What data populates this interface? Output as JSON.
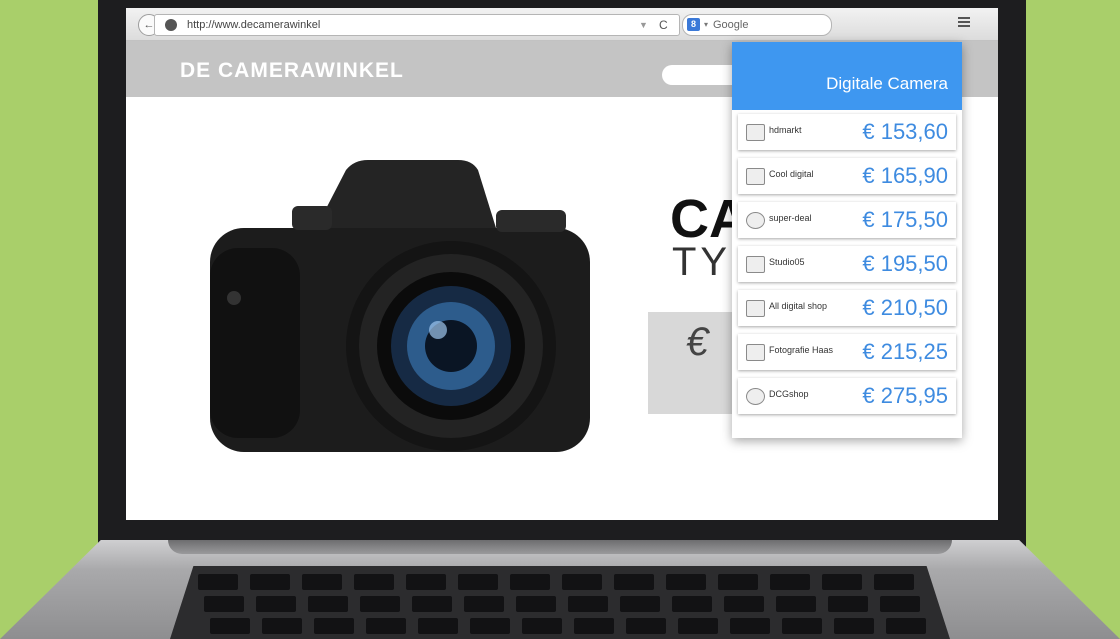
{
  "browser": {
    "url": "http://www.decamerawinkel",
    "search_placeholder": "Google",
    "search_engine_logo": "g-icon",
    "reload_glyph": "C",
    "back_glyph": "←"
  },
  "site": {
    "logo": "DE CAMERAWINKEL",
    "hero_title": "CA",
    "hero_subtitle": "TYP",
    "price_symbol": "€"
  },
  "comparison": {
    "title": "Digitale Camera",
    "accent": "#3e97f0",
    "price_color": "#3e8be0",
    "shops": [
      {
        "name": "hdmarkt",
        "price": "€ 153,60",
        "icon": "camera-icon"
      },
      {
        "name": "Cool digital",
        "price": "€ 165,90",
        "icon": "monitor-icon"
      },
      {
        "name": "super-deal",
        "price": "€ 175,50",
        "icon": "sd-badge-icon"
      },
      {
        "name": "Studio05",
        "price": "€ 195,50",
        "icon": "studio-icon"
      },
      {
        "name": "All digital shop",
        "price": "€ 210,50",
        "icon": "all-icon"
      },
      {
        "name": "Fotografie Haas",
        "price": "€ 215,25",
        "icon": "haas-icon"
      },
      {
        "name": "DCGshop",
        "price": "€ 275,95",
        "icon": "arrow-circle-icon"
      }
    ]
  }
}
